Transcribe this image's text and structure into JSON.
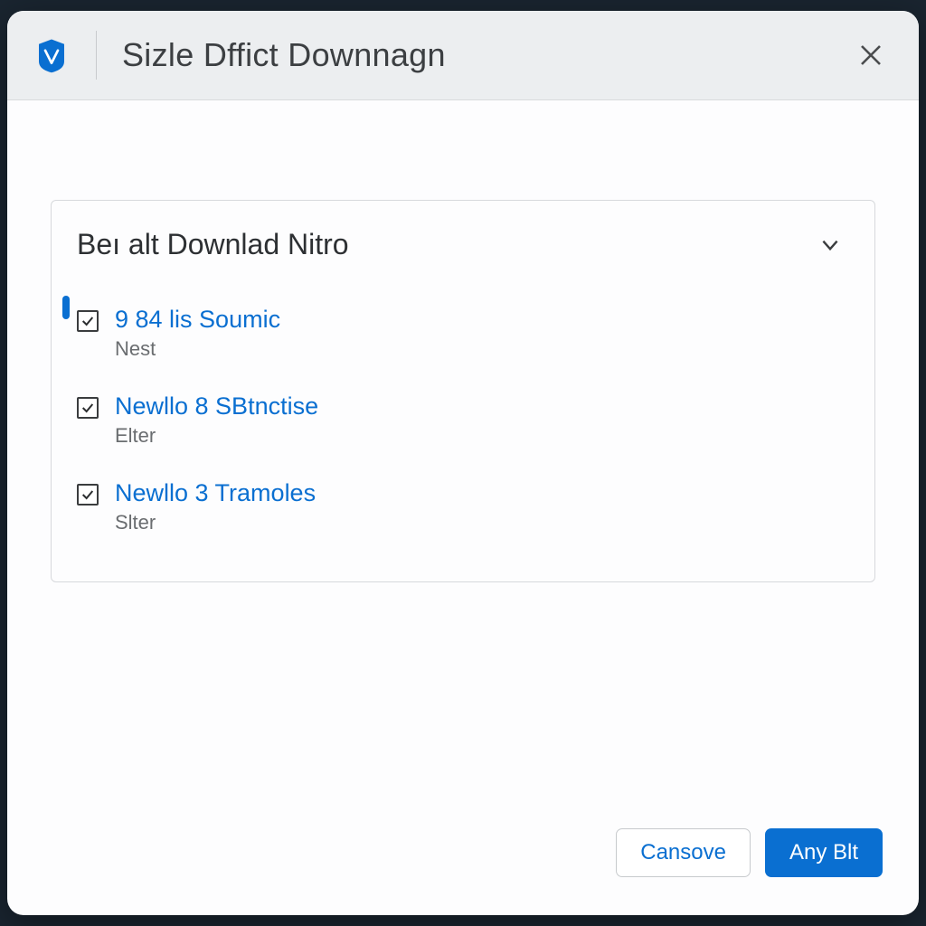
{
  "header": {
    "title": "Sizle Dffict Downnagn"
  },
  "panel": {
    "title": "Beı alt Downlad Nitro",
    "items": [
      {
        "title": "9 84 lis Soumic",
        "subtitle": "Nest",
        "checked": true,
        "active": true
      },
      {
        "title": "Newllo 8 SBtnctise",
        "subtitle": "Elter",
        "checked": true,
        "active": false
      },
      {
        "title": "Newllo 3 Tramoles",
        "subtitle": "Slter",
        "checked": true,
        "active": false
      }
    ]
  },
  "footer": {
    "secondary_label": "Cansove",
    "primary_label": "Any Blt"
  },
  "colors": {
    "accent": "#0a6fd1",
    "window_bg": "#fdfdfe",
    "titlebar_bg": "#eceef0"
  }
}
